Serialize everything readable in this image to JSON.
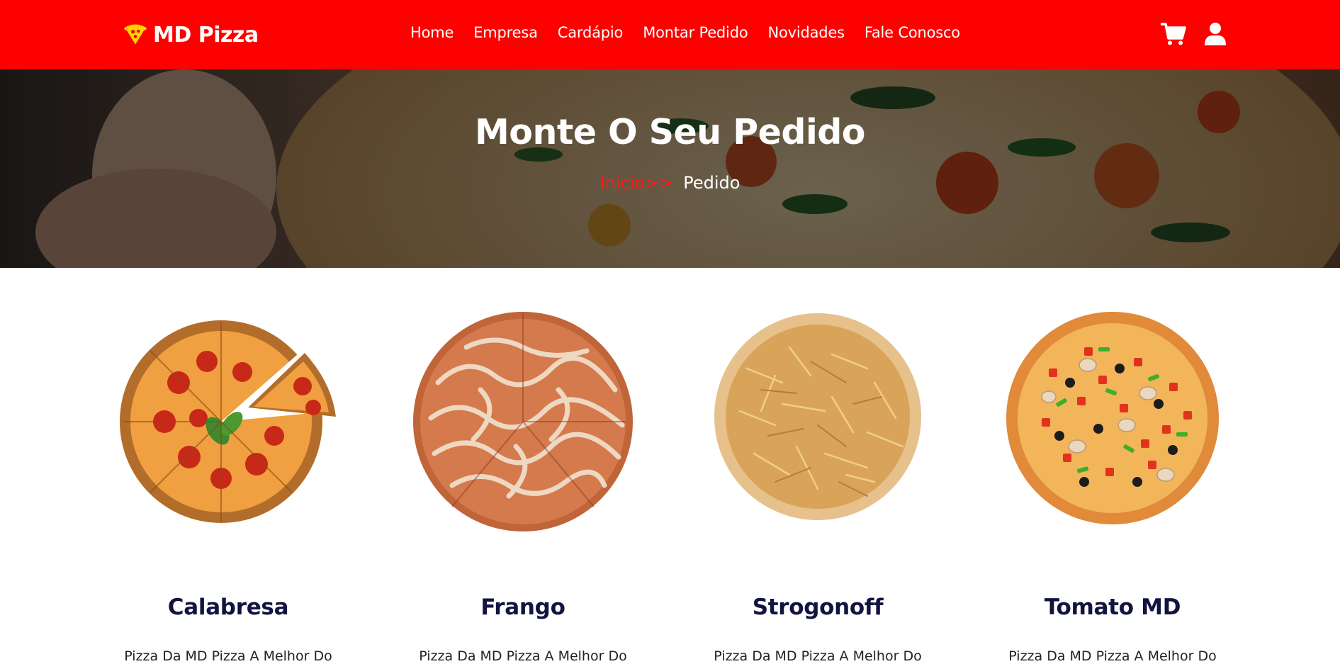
{
  "header": {
    "logo_text": "MD Pizza",
    "logo_icon": "pizza-slice-icon",
    "nav": [
      {
        "label": "Home"
      },
      {
        "label": "Empresa"
      },
      {
        "label": "Cardápio"
      },
      {
        "label": "Montar Pedido"
      },
      {
        "label": "Novidades"
      },
      {
        "label": "Fale Conosco"
      }
    ],
    "icons": [
      "cart-icon",
      "user-icon"
    ]
  },
  "hero": {
    "title": "Monte O Seu Pedido",
    "breadcrumb": {
      "link": "Inicio",
      "separator": ">>",
      "current": "Pedido"
    }
  },
  "products": [
    {
      "name": "Calabresa",
      "description": "Pizza Da MD Pizza A Melhor Do"
    },
    {
      "name": "Frango",
      "description": "Pizza Da MD Pizza A Melhor Do"
    },
    {
      "name": "Strogonoff",
      "description": "Pizza Da MD Pizza A Melhor Do"
    },
    {
      "name": "Tomato MD",
      "description": "Pizza Da MD Pizza A Melhor Do"
    }
  ],
  "colors": {
    "header_bg": "#ff0000",
    "accent": "#ff1a1a",
    "product_title": "#12133f",
    "logo_icon": "#ffd400"
  }
}
